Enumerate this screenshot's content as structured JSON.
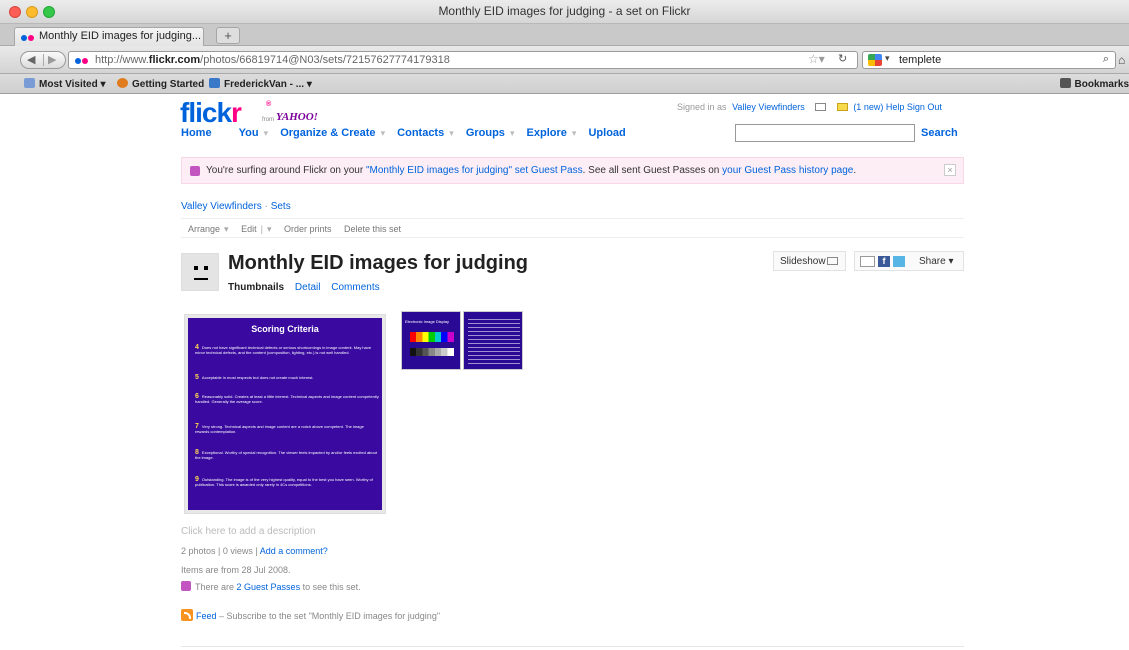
{
  "window": {
    "title": "Monthly EID images for judging - a set on Flickr"
  },
  "tab": {
    "label": "Monthly EID images for judging...",
    "new_tab": "+"
  },
  "nav": {
    "url_prefix": "http://www.",
    "url_domain": "flickr.com",
    "url_path": "/photos/66819714@N03/sets/72157627774179318",
    "search_value": "templete"
  },
  "bookmarks": {
    "items": [
      "Most Visited ▾",
      "Getting Started",
      "FrederickVan - ... ▾"
    ],
    "right": "Bookmarks"
  },
  "flickr": {
    "logo_main": "flick",
    "logo_r": "r",
    "logo_from": "from",
    "logo_yahoo": "YAHOO!",
    "signed_in_prefix": "Signed in as",
    "signed_in_user": "Valley Viewfinders",
    "new_mail": "(1 new)",
    "help": "Help",
    "sign_out": "Sign Out",
    "main_nav": [
      "Home",
      "You",
      "Organize & Create",
      "Contacts",
      "Groups",
      "Explore",
      "Upload"
    ],
    "search_button": "Search"
  },
  "guest_banner": {
    "text_a": "You're surfing around Flickr on your ",
    "set_link": "\"Monthly EID images for judging\" set Guest Pass",
    "text_b": ". See all sent Guest Passes on ",
    "history_link": "your Guest Pass history page",
    "text_c": ".",
    "close": "×"
  },
  "breadcrumb": {
    "user": "Valley Viewfinders",
    "sep": "·",
    "sets": "Sets"
  },
  "subnav": {
    "arrange": "Arrange",
    "edit": "Edit",
    "order": "Order prints",
    "delete": "Delete this set"
  },
  "set": {
    "title": "Monthly EID images for judging",
    "tabs": {
      "thumbnails": "Thumbnails",
      "detail": "Detail",
      "comments": "Comments"
    },
    "slideshow": "Slideshow",
    "share": "Share ▾",
    "facebook": "f"
  },
  "scoring": {
    "title": "Scoring Criteria",
    "criteria": [
      {
        "num": "4",
        "text": "Does not have significant technical defects or serious shortcomings in image content. May have minor technical defects, and the content (composition, lighting, etc.) is not well handled."
      },
      {
        "num": "5",
        "text": "Acceptable in most respects but does not create much interest."
      },
      {
        "num": "6",
        "text": "Reasonably solid. Creates at least a little interest. Technical aspects and image content competently handled. Generally the average score."
      },
      {
        "num": "7",
        "text": "Very strong. Technical aspects and image content are a notch above competent. The image rewards contemplation."
      },
      {
        "num": "8",
        "text": "Exceptional. Worthy of special recognition. The viewer feels impacted by and/or feels excited about the image."
      },
      {
        "num": "9",
        "text": "Outstanding. The image is of the very highest quality, equal to the best you have seen. Worthy of publication. This score is awarded only rarely in 4Cs competitions."
      }
    ],
    "thumb2_title": "Electronic Image Display"
  },
  "info": {
    "description": "Click here to add a description",
    "stats": "2 photos | 0 views | ",
    "add_comment": "Add a comment?",
    "items_date": "Items are from 28 Jul 2008.",
    "guest_prefix": "There are ",
    "guest_link": "2 Guest Passes",
    "guest_suffix": " to see this set.",
    "feed_link": "Feed",
    "feed_text": " – Subscribe to the set \"Monthly EID images for judging\""
  }
}
